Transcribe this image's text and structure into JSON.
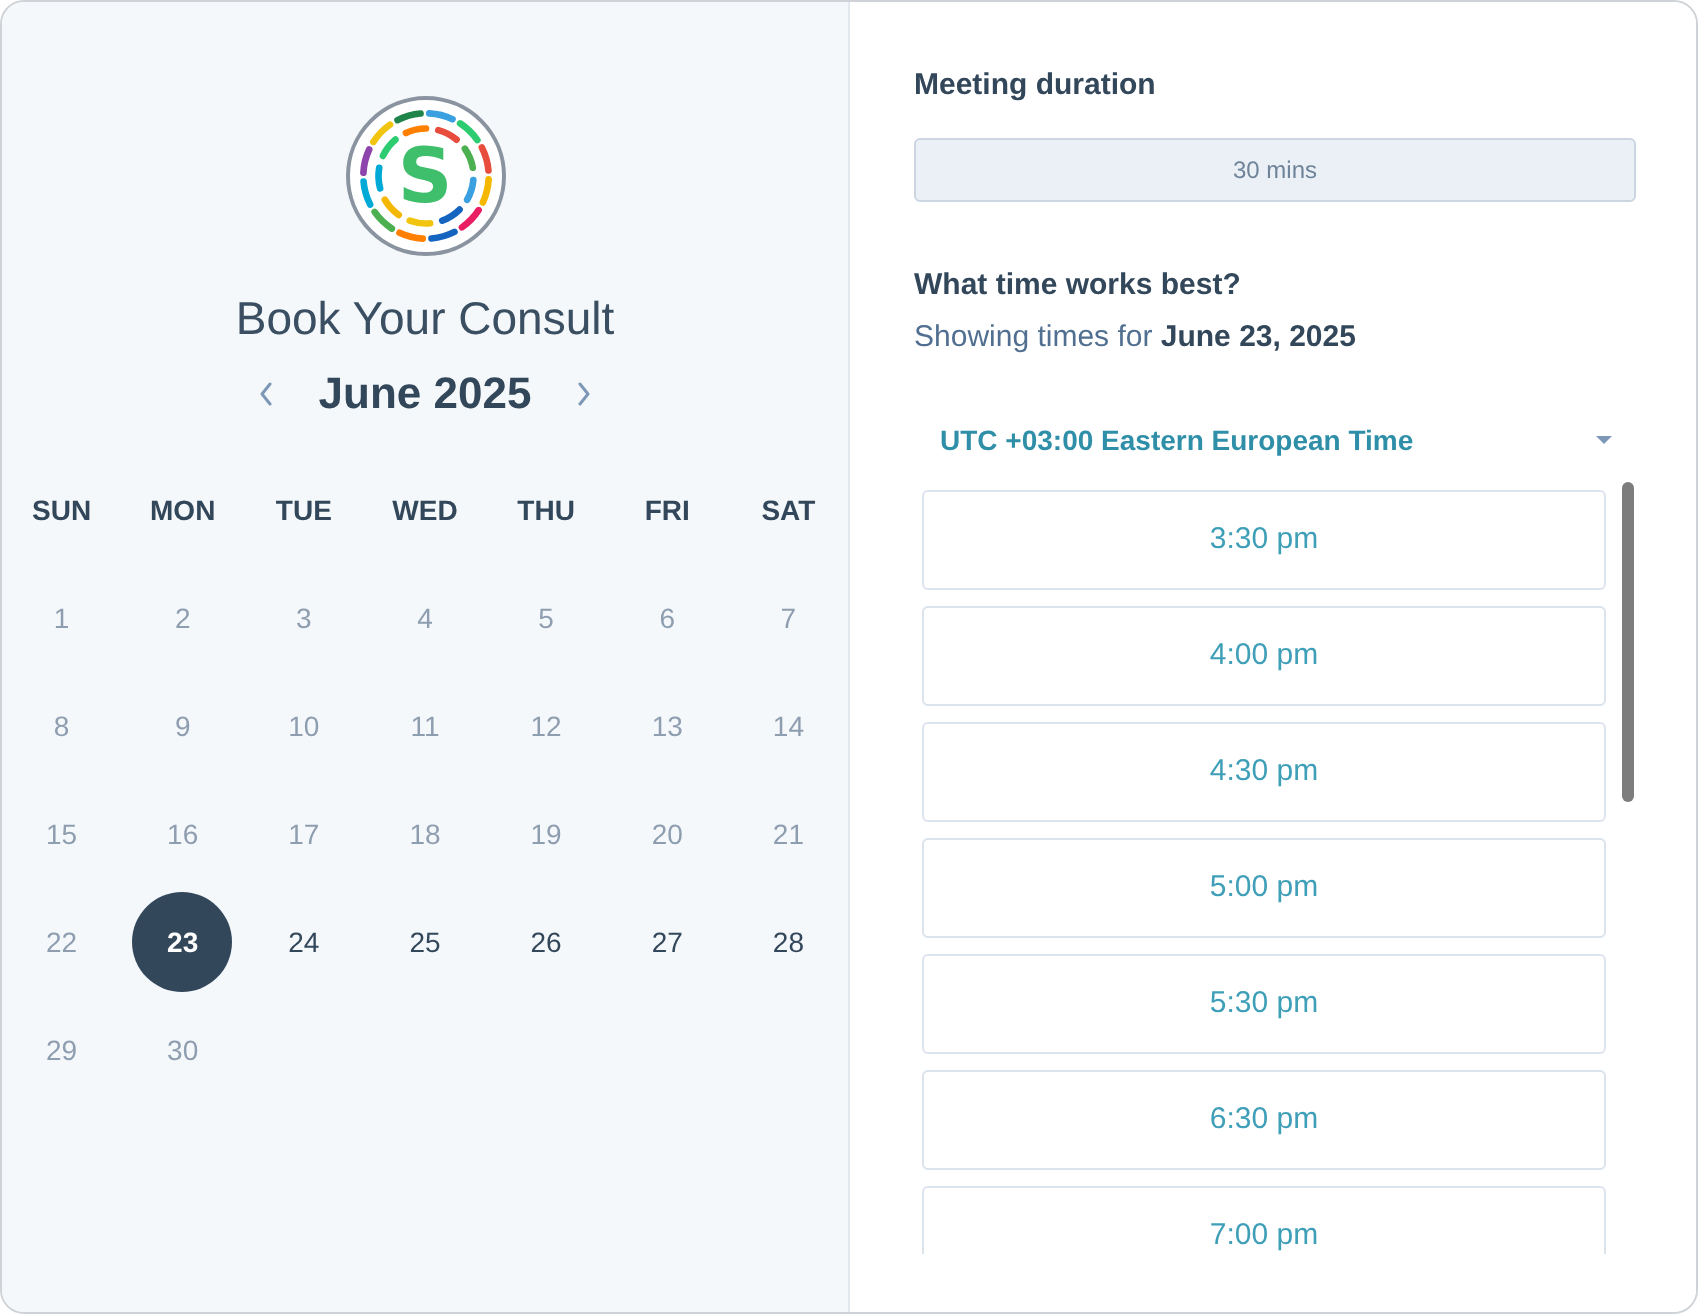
{
  "logo": {
    "letter": "S"
  },
  "title": "Book Your Consult",
  "calendar": {
    "month": "June 2025",
    "weekdays": [
      "SUN",
      "MON",
      "TUE",
      "WED",
      "THU",
      "FRI",
      "SAT"
    ],
    "days": [
      {
        "label": "1",
        "disabled": true,
        "selected": false
      },
      {
        "label": "2",
        "disabled": true,
        "selected": false
      },
      {
        "label": "3",
        "disabled": true,
        "selected": false
      },
      {
        "label": "4",
        "disabled": true,
        "selected": false
      },
      {
        "label": "5",
        "disabled": true,
        "selected": false
      },
      {
        "label": "6",
        "disabled": true,
        "selected": false
      },
      {
        "label": "7",
        "disabled": true,
        "selected": false
      },
      {
        "label": "8",
        "disabled": true,
        "selected": false
      },
      {
        "label": "9",
        "disabled": true,
        "selected": false
      },
      {
        "label": "10",
        "disabled": true,
        "selected": false
      },
      {
        "label": "11",
        "disabled": true,
        "selected": false
      },
      {
        "label": "12",
        "disabled": true,
        "selected": false
      },
      {
        "label": "13",
        "disabled": true,
        "selected": false
      },
      {
        "label": "14",
        "disabled": true,
        "selected": false
      },
      {
        "label": "15",
        "disabled": true,
        "selected": false
      },
      {
        "label": "16",
        "disabled": true,
        "selected": false
      },
      {
        "label": "17",
        "disabled": true,
        "selected": false
      },
      {
        "label": "18",
        "disabled": true,
        "selected": false
      },
      {
        "label": "19",
        "disabled": true,
        "selected": false
      },
      {
        "label": "20",
        "disabled": true,
        "selected": false
      },
      {
        "label": "21",
        "disabled": true,
        "selected": false
      },
      {
        "label": "22",
        "disabled": true,
        "selected": false
      },
      {
        "label": "23",
        "disabled": false,
        "selected": true
      },
      {
        "label": "24",
        "disabled": false,
        "selected": false
      },
      {
        "label": "25",
        "disabled": false,
        "selected": false
      },
      {
        "label": "26",
        "disabled": false,
        "selected": false
      },
      {
        "label": "27",
        "disabled": false,
        "selected": false
      },
      {
        "label": "28",
        "disabled": false,
        "selected": false
      },
      {
        "label": "29",
        "disabled": true,
        "selected": false
      },
      {
        "label": "30",
        "disabled": true,
        "selected": false
      }
    ]
  },
  "duration": {
    "label": "Meeting duration",
    "value": "30 mins"
  },
  "times": {
    "heading": "What time works best?",
    "subtitle": "Showing times for **June 23, 2025**",
    "timezone": "UTC +03:00 Eastern European Time",
    "slots": [
      "3:30 pm",
      "4:00 pm",
      "4:30 pm",
      "5:00 pm",
      "5:30 pm",
      "6:30 pm",
      "7:00 pm"
    ]
  }
}
